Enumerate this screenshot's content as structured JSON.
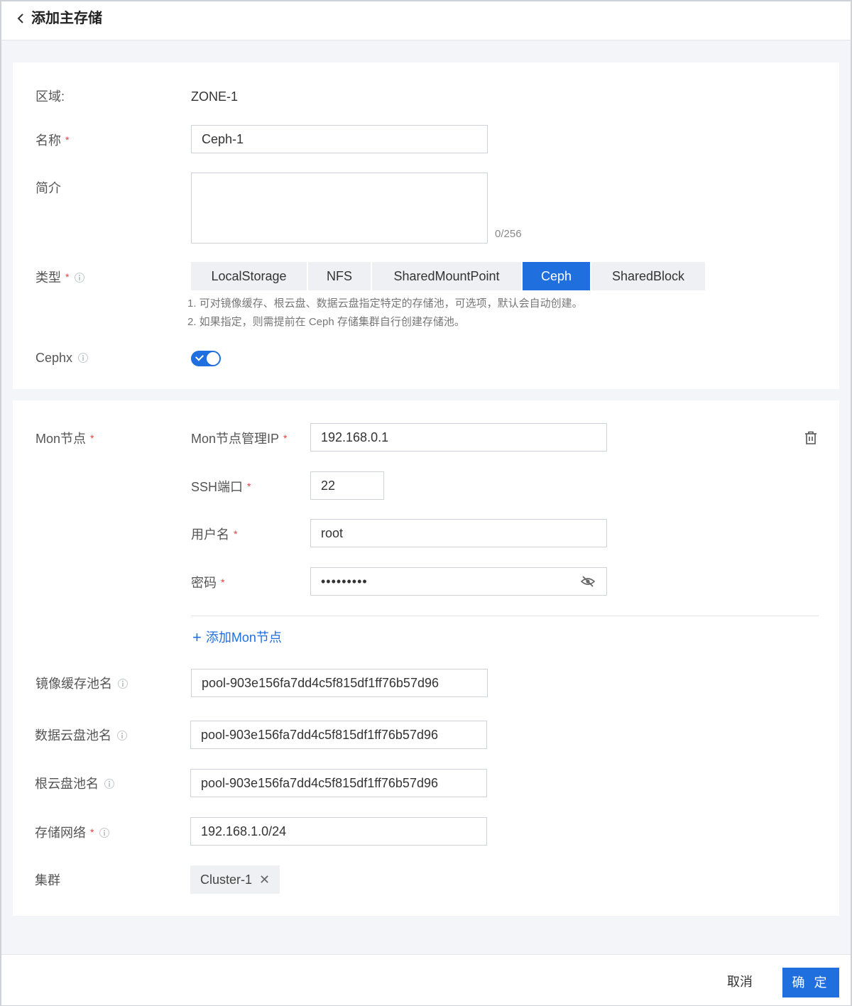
{
  "header": {
    "title": "添加主存储"
  },
  "zone": {
    "label": "区域:",
    "value": "ZONE-1"
  },
  "name": {
    "label": "名称",
    "value": "Ceph-1"
  },
  "description": {
    "label": "简介",
    "value": "",
    "counter": "0/256"
  },
  "type": {
    "label": "类型",
    "options": [
      "LocalStorage",
      "NFS",
      "SharedMountPoint",
      "Ceph",
      "SharedBlock"
    ],
    "selected": "Ceph",
    "hints": [
      "1. 可对镜像缓存、根云盘、数据云盘指定特定的存储池，可选项，默认会自动创建。",
      "2. 如果指定，则需提前在 Ceph 存储集群自行创建存储池。"
    ]
  },
  "cephx": {
    "label": "Cephx",
    "enabled": true
  },
  "mon": {
    "label": "Mon节点",
    "ip_label": "Mon节点管理IP",
    "ip_value": "192.168.0.1",
    "ssh_label": "SSH端口",
    "ssh_value": "22",
    "user_label": "用户名",
    "user_value": "root",
    "pwd_label": "密码",
    "pwd_value": "•••••••••",
    "add_label": "添加Mon节点"
  },
  "pools": {
    "image_cache_label": "镜像缓存池名",
    "image_cache_value": "pool-903e156fa7dd4c5f815df1ff76b57d96",
    "data_label": "数据云盘池名",
    "data_value": "pool-903e156fa7dd4c5f815df1ff76b57d96",
    "root_label": "根云盘池名",
    "root_value": "pool-903e156fa7dd4c5f815df1ff76b57d96"
  },
  "network": {
    "label": "存储网络",
    "value": "192.168.1.0/24"
  },
  "cluster": {
    "label": "集群",
    "tag": "Cluster-1"
  },
  "footer": {
    "cancel": "取消",
    "ok": "确 定"
  },
  "colors": {
    "accent": "#1f6fde",
    "required": "#e5413b"
  }
}
